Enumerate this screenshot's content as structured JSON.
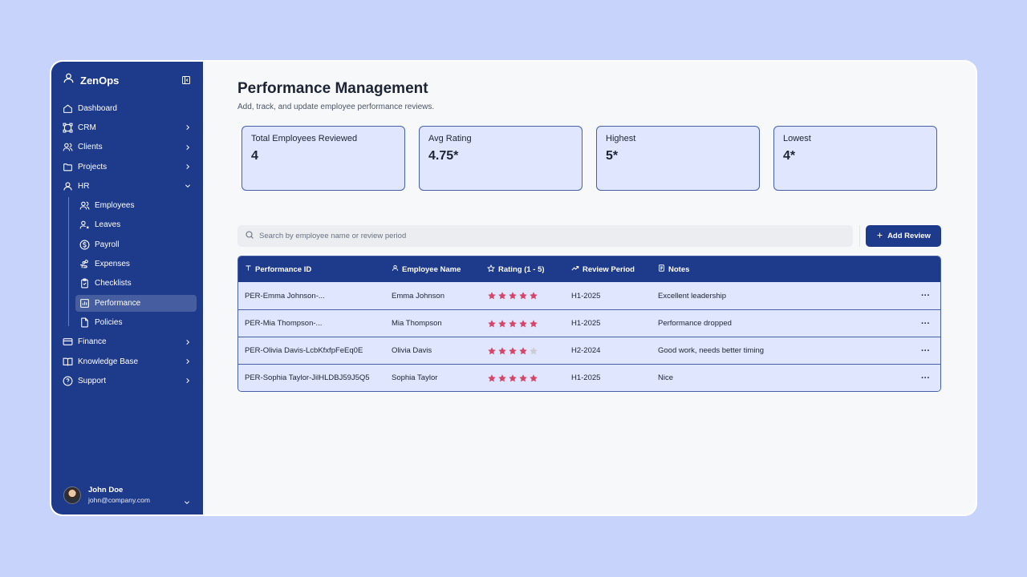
{
  "app": {
    "name": "ZenOps"
  },
  "sidebar": {
    "items": [
      {
        "label": "Dashboard",
        "icon": "home-icon",
        "chevron": false
      },
      {
        "label": "CRM",
        "icon": "crm-icon",
        "chevron": true
      },
      {
        "label": "Clients",
        "icon": "users-icon",
        "chevron": true
      },
      {
        "label": "Projects",
        "icon": "folder-icon",
        "chevron": true
      },
      {
        "label": "HR",
        "icon": "user-icon",
        "chevron": "down"
      }
    ],
    "hr_sub": [
      {
        "label": "Employees",
        "icon": "users-icon"
      },
      {
        "label": "Leaves",
        "icon": "user-x-icon"
      },
      {
        "label": "Payroll",
        "icon": "dollar-icon"
      },
      {
        "label": "Expenses",
        "icon": "hand-coins-icon"
      },
      {
        "label": "Checklists",
        "icon": "clipboard-check-icon"
      },
      {
        "label": "Performance",
        "icon": "bar-chart-icon",
        "active": true
      },
      {
        "label": "Policies",
        "icon": "file-icon"
      }
    ],
    "bottom_items": [
      {
        "label": "Finance",
        "icon": "credit-card-icon"
      },
      {
        "label": "Knowledge Base",
        "icon": "book-icon"
      },
      {
        "label": "Support",
        "icon": "help-circle-icon"
      }
    ],
    "user": {
      "name": "John Doe",
      "email": "john@company.com"
    }
  },
  "page": {
    "title": "Performance Management",
    "subtitle": "Add, track, and update employee performance reviews."
  },
  "stats": [
    {
      "label": "Total Employees Reviewed",
      "value": "4"
    },
    {
      "label": "Avg Rating",
      "value": "4.75*"
    },
    {
      "label": "Highest",
      "value": "5*"
    },
    {
      "label": "Lowest",
      "value": "4*"
    }
  ],
  "search": {
    "placeholder": "Search by employee name or review period"
  },
  "toolbar": {
    "add_label": "Add Review"
  },
  "table": {
    "headers": [
      "Performance ID",
      "Employee Name",
      "Rating (1 - 5)",
      "Review Period",
      "Notes"
    ],
    "rows": [
      {
        "id": "PER-Emma Johnson-...",
        "name": "Emma Johnson",
        "rating": 5,
        "period": "H1-2025",
        "notes": "Excellent leadership"
      },
      {
        "id": "PER-Mia Thompson-...",
        "name": "Mia Thompson",
        "rating": 5,
        "period": "H1-2025",
        "notes": "Performance dropped"
      },
      {
        "id": "PER-Olivia Davis-LcbKfxfpFeEq0E",
        "name": "Olivia Davis",
        "rating": 4,
        "period": "H2-2024",
        "notes": "Good work, needs better timing"
      },
      {
        "id": "PER-Sophia Taylor-JilHLDBJ59J5Q5",
        "name": "Sophia Taylor",
        "rating": 5,
        "period": "H1-2025",
        "notes": "Nice"
      }
    ],
    "more_label": "···"
  },
  "colors": {
    "sidebar": "#1e3a8a",
    "card": "#dfe6fd",
    "star_filled": "#d6456a",
    "star_empty": "#c9ccd3",
    "page_bg": "#c7d3fb"
  }
}
